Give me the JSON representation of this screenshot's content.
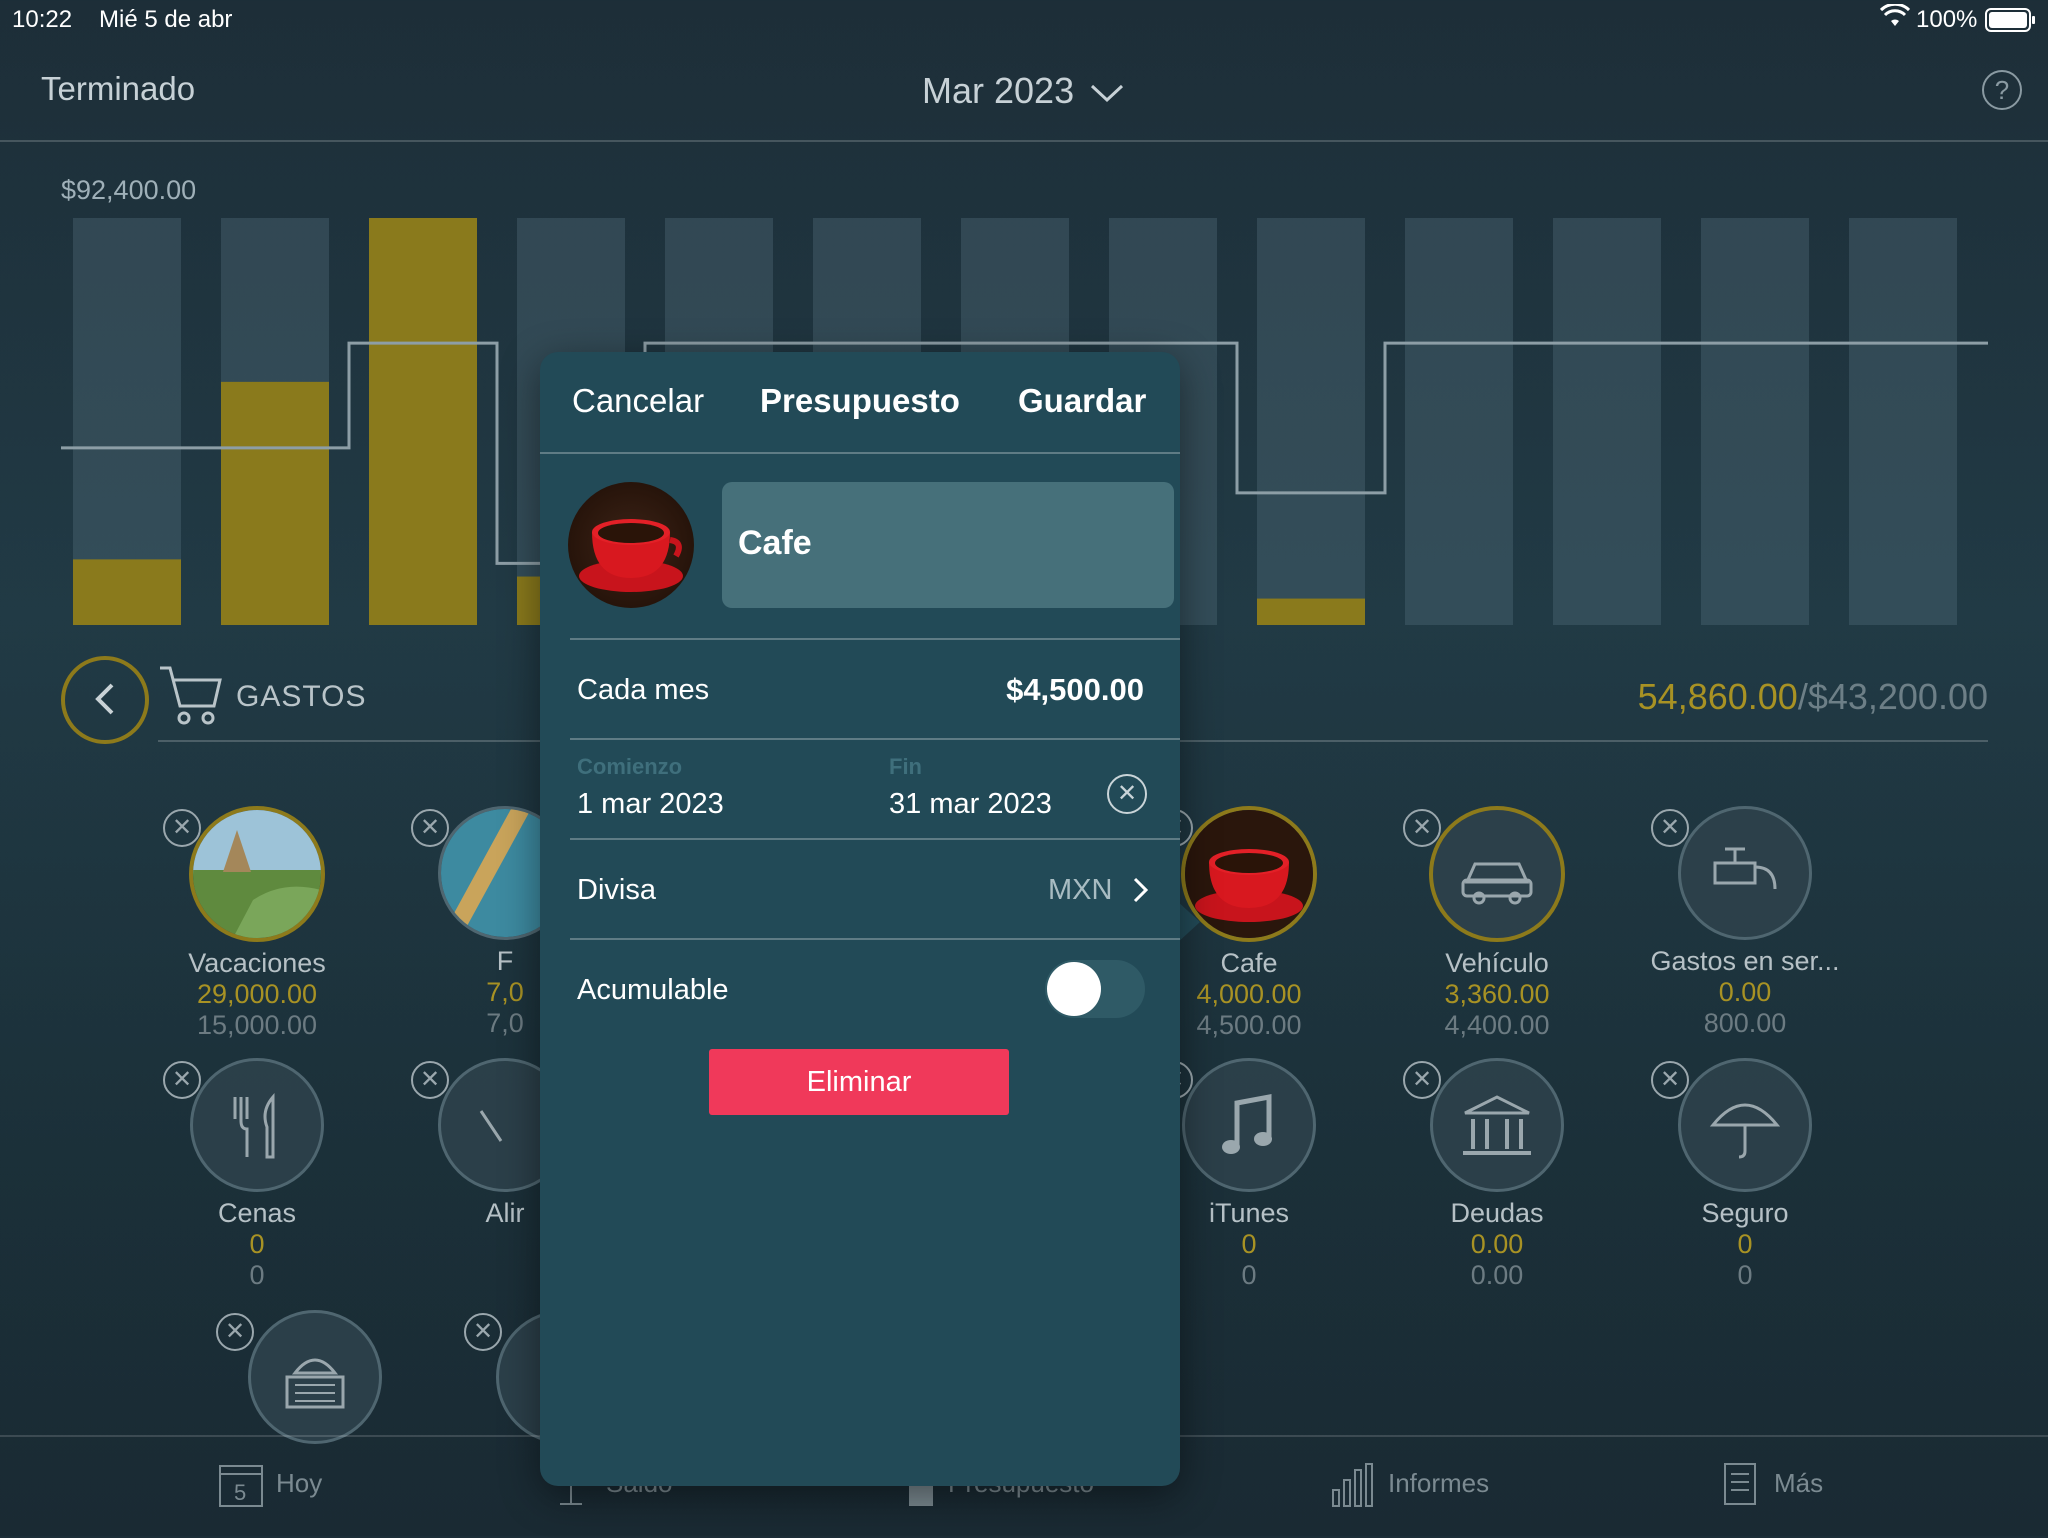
{
  "status_bar": {
    "time": "10:22",
    "date": "Mié 5 de abr",
    "battery": "100%"
  },
  "nav": {
    "left": "Terminado",
    "title": "Mar 2023",
    "help": "?"
  },
  "chart_data": {
    "type": "bar",
    "max_label": "$92,400.00",
    "ylim": [
      0,
      92400
    ],
    "series": [
      {
        "name": "spent",
        "values": [
          14900,
          55200,
          92400,
          11000,
          null,
          null,
          null,
          null,
          6000,
          0,
          0,
          0,
          0
        ]
      }
    ],
    "budget_line": [
      40200,
      40200,
      64000,
      14000,
      64000,
      64000,
      64000,
      64000,
      30000,
      64000,
      64000,
      64000,
      64000
    ]
  },
  "section": {
    "title": "GASTOS",
    "spent_total": "54,860.00",
    "budget_total": "/$43,200.00"
  },
  "categories": [
    {
      "name": "Vacaciones",
      "spent": "29,000.00",
      "budget": "15,000.00",
      "icon": "landscape-photo-icon"
    },
    {
      "name": "F",
      "spent": "7,0",
      "budget": "7,0",
      "icon": "photo-icon"
    },
    {
      "name": "Cafe",
      "spent": "4,000.00",
      "budget": "4,500.00",
      "icon": "coffee-cup-photo-icon"
    },
    {
      "name": "Vehículo",
      "spent": "3,360.00",
      "budget": "4,400.00",
      "icon": "car-icon"
    },
    {
      "name": "Gastos en ser...",
      "spent": "0.00",
      "budget": "800.00",
      "icon": "faucet-icon"
    },
    {
      "name": "Cenas",
      "spent": "0",
      "budget": "0",
      "icon": "fork-knife-icon"
    },
    {
      "name": "Alir",
      "spent": "",
      "budget": "",
      "icon": "food-icon"
    },
    {
      "name": "iTunes",
      "spent": "0",
      "budget": "0",
      "icon": "music-note-icon"
    },
    {
      "name": "Deudas",
      "spent": "0.00",
      "budget": "0.00",
      "icon": "bank-icon"
    },
    {
      "name": "Seguro",
      "spent": "0",
      "budget": "0",
      "icon": "umbrella-icon"
    }
  ],
  "tabs": [
    {
      "label": "Hoy",
      "icon": "calendar-icon",
      "badge": "5"
    },
    {
      "label": "Saldo",
      "icon": "scale-icon"
    },
    {
      "label": "Presupuesto",
      "icon": "budget-icon"
    },
    {
      "label": "Informes",
      "icon": "bar-chart-icon"
    },
    {
      "label": "Más",
      "icon": "document-icon"
    }
  ],
  "popover": {
    "cancel": "Cancelar",
    "title": "Presupuesto",
    "save": "Guardar",
    "name_value": "Cafe",
    "period_label": "Cada mes",
    "amount": "$4,500.00",
    "start_label": "Comienzo",
    "start_value": "1 mar 2023",
    "end_label": "Fin",
    "end_value": "31 mar 2023",
    "currency_label": "Divisa",
    "currency_value": "MXN",
    "cumulative_label": "Acumulable",
    "cumulative_on": false,
    "delete": "Eliminar"
  }
}
